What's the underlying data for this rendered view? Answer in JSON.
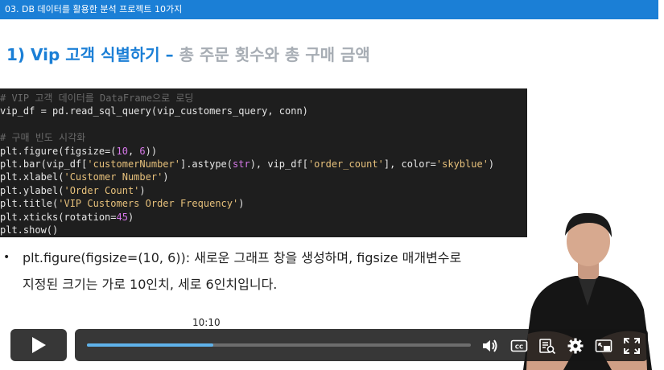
{
  "slide": {
    "breadcrumb": "03. DB 데이터를 활용한 분석 프로젝트 10가지",
    "heading_highlight": "1) Vip 고객 식별하기 –",
    "heading_rest": " 총 주문 횟수와 총 구매 금액",
    "code_lines": [
      [
        {
          "t": "# VIP 고객 데이터를 DataFrame으로 로딩",
          "c": "comment"
        }
      ],
      [
        {
          "t": "vip_df = pd.read_sql_query(vip_customers_query, conn)",
          "c": ""
        }
      ],
      [
        {
          "t": "",
          "c": ""
        }
      ],
      [
        {
          "t": "# 구매 빈도 시각화",
          "c": "comment"
        }
      ],
      [
        {
          "t": "plt.figure(figsize=(",
          "c": ""
        },
        {
          "t": "10",
          "c": "num"
        },
        {
          "t": ", ",
          "c": ""
        },
        {
          "t": "6",
          "c": "num"
        },
        {
          "t": "))",
          "c": ""
        }
      ],
      [
        {
          "t": "plt.bar(vip_df[",
          "c": ""
        },
        {
          "t": "'customerNumber'",
          "c": "str"
        },
        {
          "t": "].astype(",
          "c": ""
        },
        {
          "t": "str",
          "c": "kw"
        },
        {
          "t": "), vip_df[",
          "c": ""
        },
        {
          "t": "'order_count'",
          "c": "str"
        },
        {
          "t": "], color=",
          "c": ""
        },
        {
          "t": "'skyblue'",
          "c": "str"
        },
        {
          "t": ")",
          "c": ""
        }
      ],
      [
        {
          "t": "plt.xlabel(",
          "c": ""
        },
        {
          "t": "'Customer Number'",
          "c": "str"
        },
        {
          "t": ")",
          "c": ""
        }
      ],
      [
        {
          "t": "plt.ylabel(",
          "c": ""
        },
        {
          "t": "'Order Count'",
          "c": "str"
        },
        {
          "t": ")",
          "c": ""
        }
      ],
      [
        {
          "t": "plt.title(",
          "c": ""
        },
        {
          "t": "'VIP Customers Order Frequency'",
          "c": "str"
        },
        {
          "t": ")",
          "c": ""
        }
      ],
      [
        {
          "t": "plt.xticks(rotation=",
          "c": ""
        },
        {
          "t": "45",
          "c": "num"
        },
        {
          "t": ")",
          "c": ""
        }
      ],
      [
        {
          "t": "plt.show()",
          "c": ""
        }
      ]
    ],
    "bullet_marker": "•",
    "bullet_line1": "plt.figure(figsize=(10, 6)): 새로운 그래프 창을 생성하며, figsize 매개변수로",
    "bullet_line2": "지정된 크기는 가로 10인치, 세로 6인치입니다."
  },
  "player": {
    "hover_time": "10:10",
    "progress_fraction": 0.33,
    "colors": {
      "progress": "#5fb2ea",
      "track": "#6d6d6d",
      "controls_bg": "#141414",
      "accent": "#1b7fd6"
    },
    "icons": [
      "play-icon",
      "volume-icon",
      "captions-icon",
      "transcript-icon",
      "settings-icon",
      "pip-icon",
      "fullscreen-icon"
    ]
  }
}
